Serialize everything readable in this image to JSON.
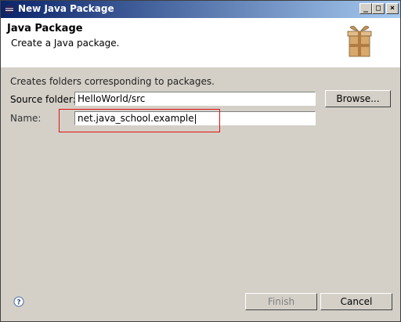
{
  "window": {
    "title": "New Java Package"
  },
  "title_buttons": {
    "minimize": "_",
    "maximize": "□",
    "close": "×"
  },
  "header": {
    "title": "Java Package",
    "description": "Create a Java package.",
    "banner_icon": "package-box-icon"
  },
  "form": {
    "info": "Creates folders corresponding to packages.",
    "source_folder": {
      "label": "Source folder:",
      "value": "HelloWorld/src"
    },
    "name": {
      "label": "Name:",
      "value": "net.java_school.example"
    },
    "browse_label": "Browse..."
  },
  "footer": {
    "help_icon": "help-icon",
    "finish_label": "Finish",
    "finish_enabled": false,
    "cancel_label": "Cancel"
  },
  "colors": {
    "titlebar_start": "#0a246a",
    "titlebar_end": "#a6caf0",
    "dialog_bg": "#d4d0c8",
    "highlight": "#e01010"
  }
}
